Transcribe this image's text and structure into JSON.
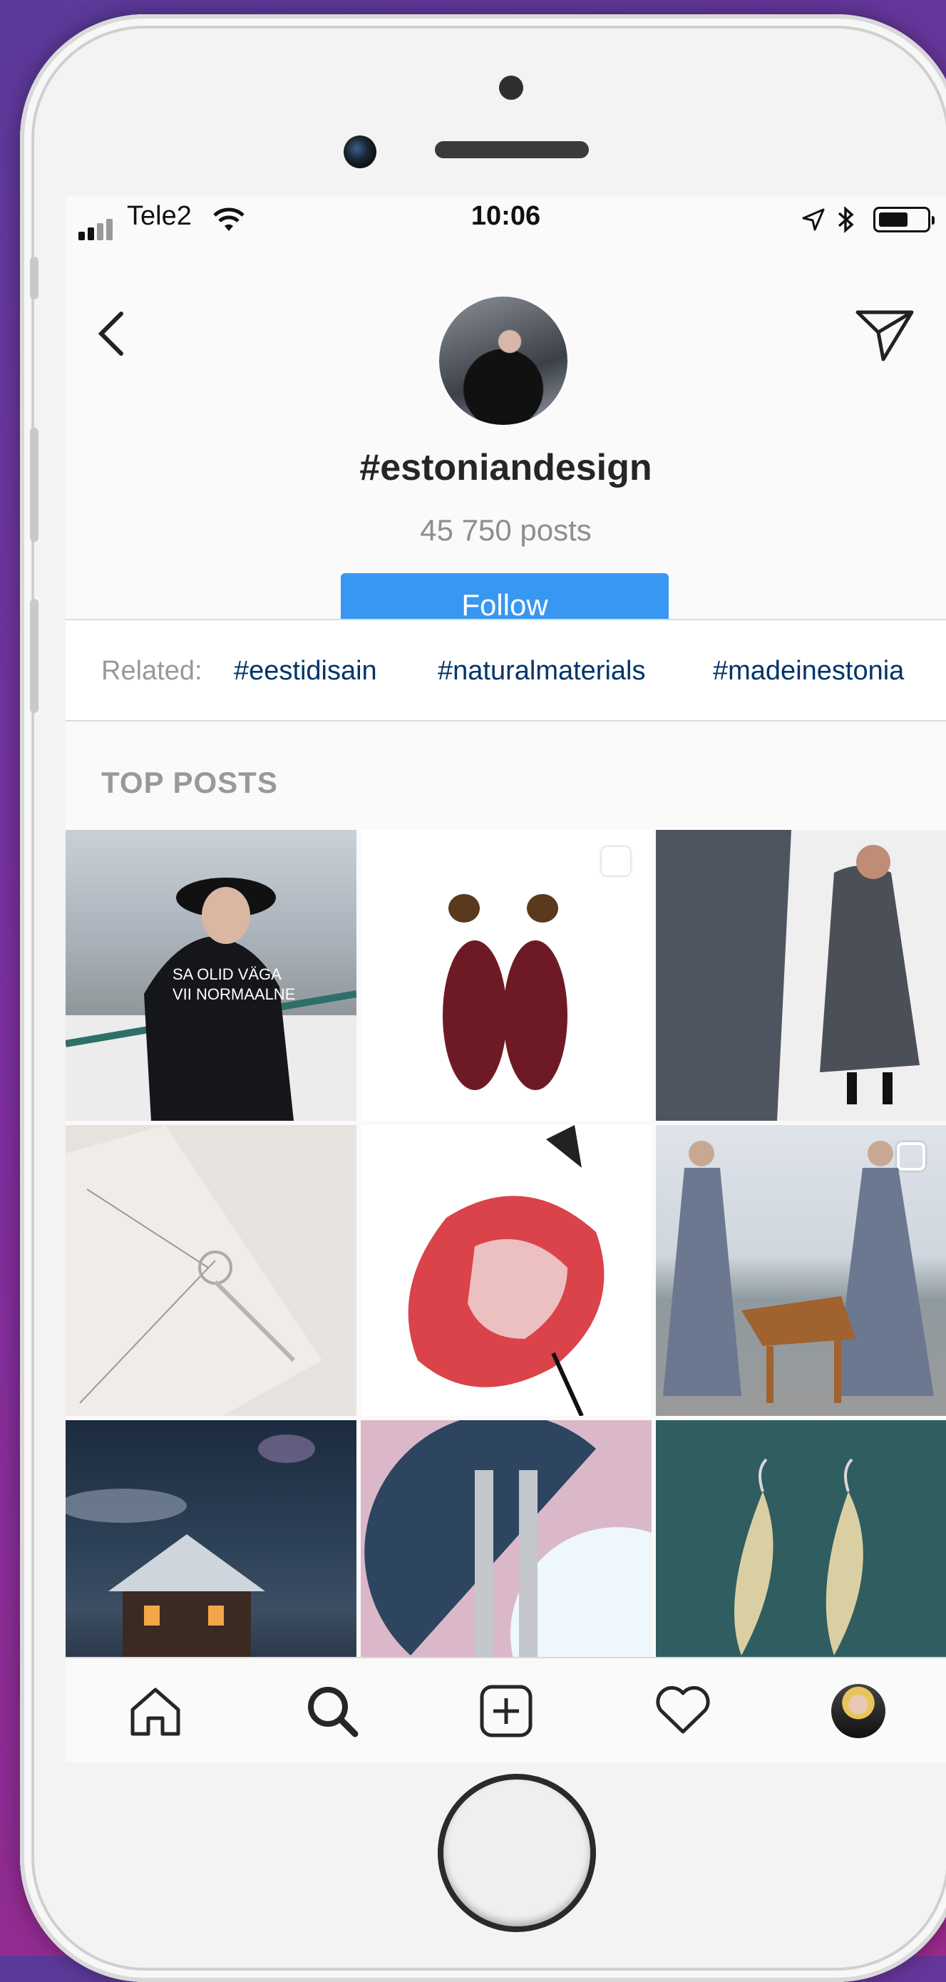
{
  "status_bar": {
    "carrier": "Tele2",
    "time": "10:06"
  },
  "header": {
    "hashtag": "#estoniandesign",
    "post_count": "45 750 posts",
    "follow_label": "Follow"
  },
  "related": {
    "label": "Related:",
    "tags": [
      "#eestidisain",
      "#naturalmaterials",
      "#madeinestonia"
    ]
  },
  "section": {
    "title": "TOP POSTS"
  },
  "posts": [
    {
      "name": "post-woman-sweatshirt",
      "multi": false
    },
    {
      "name": "post-red-earrings",
      "multi": true
    },
    {
      "name": "post-grey-dress",
      "multi": false
    },
    {
      "name": "post-pendant-necklace",
      "multi": false
    },
    {
      "name": "post-red-illustration",
      "multi": false
    },
    {
      "name": "post-dresses-dog",
      "multi": true
    },
    {
      "name": "post-cabin-night",
      "multi": false
    },
    {
      "name": "post-geometric-earrings",
      "multi": false
    },
    {
      "name": "post-leaf-earrings",
      "multi": false
    }
  ],
  "tabbar": {
    "items": [
      "home-icon",
      "search-icon",
      "add-post-icon",
      "activity-heart-icon",
      "profile-avatar"
    ],
    "active": "search-icon"
  },
  "colors": {
    "accent": "#3897f0",
    "link": "#003569"
  }
}
